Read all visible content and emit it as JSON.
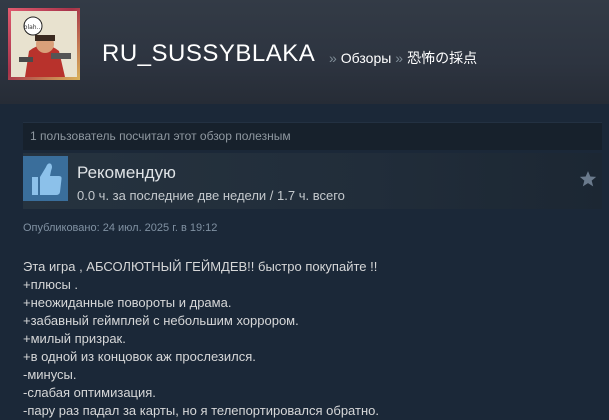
{
  "header": {
    "persona_name": "RU_SUSSYBLAKA",
    "breadcrumb": {
      "separator": "»",
      "reviews": "Обзоры",
      "game": "恐怖の採点"
    },
    "avatar_caption": "blah..."
  },
  "helpful_text": "1 пользователь посчитал этот обзор полезным",
  "review": {
    "verdict": "Рекомендую",
    "hours": "0.0 ч. за последние две недели / 1.7 ч. всего",
    "posted": "Опубликовано: 24 июл. 2025 г. в 19:12",
    "body_lines": [
      "Эта игра , АБСОЛЮТНЫЙ ГЕЙМДЕВ!! быстро покупайте !!",
      "+плюсы .",
      "+неожиданные повороты и драма.",
      "+забавный геймплей с небольшим хоррором.",
      "+милый призрак.",
      "+в одной из концовок аж прослезился.",
      "-минусы.",
      "-слабая оптимизация.",
      "-пару раз падал за карты, но я телепортировался обратно."
    ]
  },
  "icons": {
    "thumb": "thumbs-up-icon",
    "star": "star-icon"
  },
  "colors": {
    "background": "#1b2838",
    "thumb_box": "#3a6e9b",
    "link": "#ffffff",
    "muted": "#8f98a0"
  }
}
